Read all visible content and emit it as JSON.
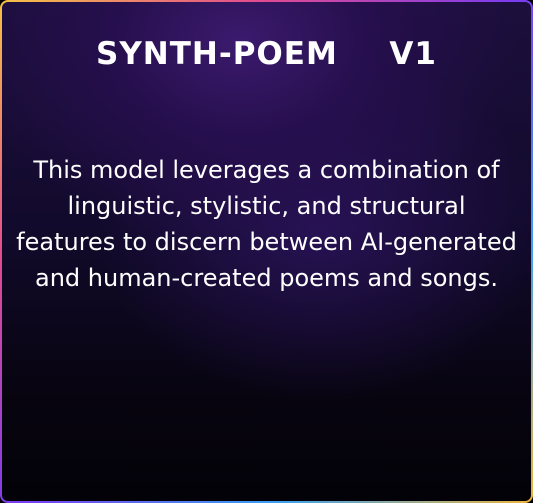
{
  "card": {
    "title": "SYNTH-POEM  V1",
    "description": "This model leverages a combination of linguistic, stylistic, and structural features to discern between AI-generated and human-created poems and songs."
  }
}
